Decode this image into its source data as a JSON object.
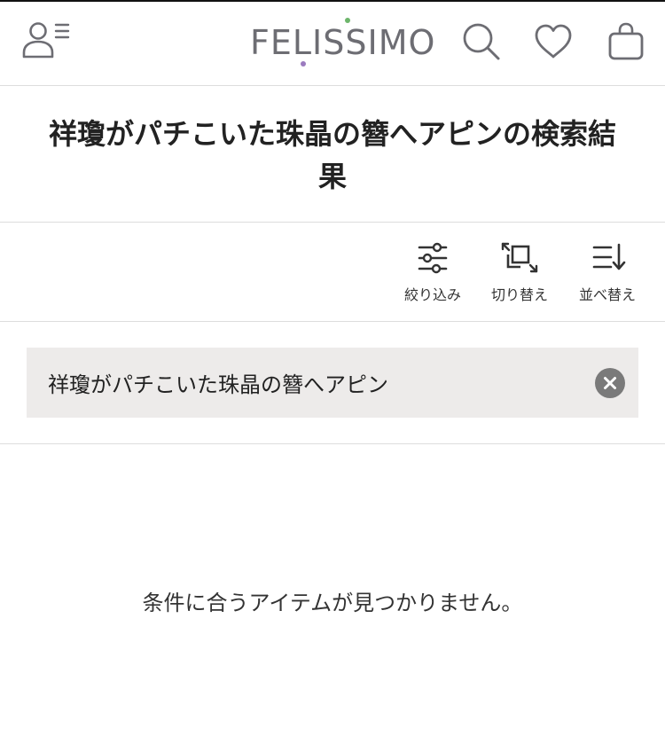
{
  "header": {
    "logo_text": "FELISSIMO",
    "logo_dot_colors": [
      "#6db56b",
      "#9b7bbf"
    ],
    "icons": [
      "account-menu-icon",
      "search-icon",
      "heart-icon",
      "shopping-bag-icon"
    ]
  },
  "title": {
    "text": "祥瓊がパチこいた珠晶の簪へアピンの検索結果"
  },
  "toolbar": {
    "filter_label": "絞り込み",
    "switch_label": "切り替え",
    "sort_label": "並べ替え"
  },
  "search": {
    "value": "祥瓊がパチこいた珠晶の簪へアピン"
  },
  "results": {
    "empty_message": "条件に合うアイテムが見つかりません。"
  },
  "colors": {
    "logo": "#6d6d73",
    "search_box_bg": "#edebea",
    "clear_button": "#7a7a7a",
    "divider": "#dddddd"
  }
}
